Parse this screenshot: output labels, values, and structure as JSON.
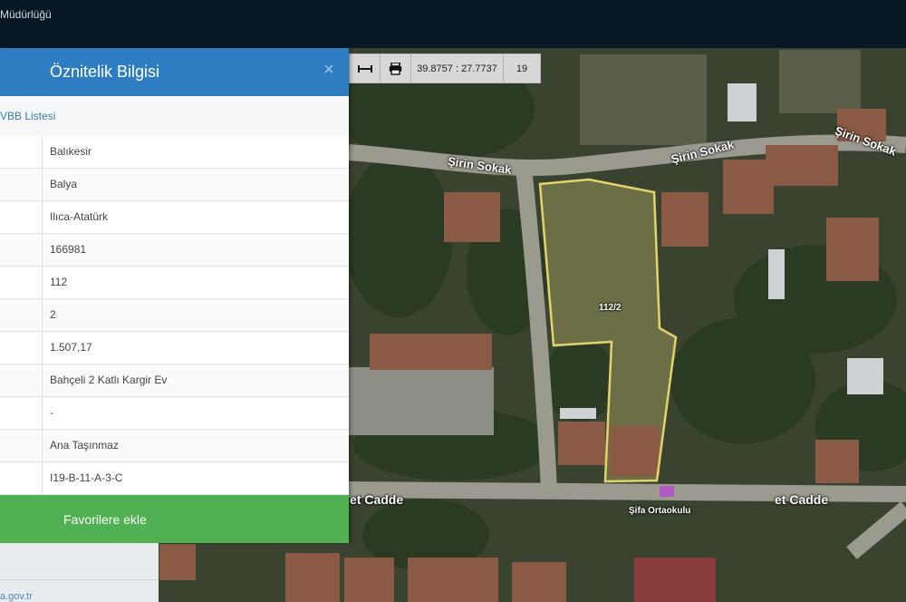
{
  "header": {
    "brand": "Müdürlüğü"
  },
  "toolbar": {
    "measure_icon": "measure-icon",
    "print_icon": "print-icon",
    "coordinates": "39.8757 : 27.7737",
    "zoom": "19"
  },
  "panel": {
    "title": "Öznitelik Bilgisi",
    "close_label": "×",
    "sub_link": "VBB Listesi",
    "rows": [
      {
        "value": "Balıkesir"
      },
      {
        "value": "Balya"
      },
      {
        "value": "Ilıca-Atatürk"
      },
      {
        "value": "166981"
      },
      {
        "value": "112"
      },
      {
        "value": "2"
      },
      {
        "value": "1.507,17"
      },
      {
        "value": "Bahçeli 2 Katlı Kargir Ev"
      },
      {
        "value": "-"
      },
      {
        "value": "Ana Taşınmaz"
      },
      {
        "value": "I19-B-11-A-3-C"
      }
    ],
    "favorite_button": "Favorilere ekle"
  },
  "footer": {
    "link": "a.gov.tr"
  },
  "map": {
    "parcel_label": "112/2",
    "street_1": "Şirin Sokak",
    "street_2": "Şirin Sokak",
    "avenue_1": "et Cadde",
    "avenue_2": "et Cadde",
    "poi": "Şifa Ortaokulu",
    "parcel_color": "#e3d36c"
  }
}
